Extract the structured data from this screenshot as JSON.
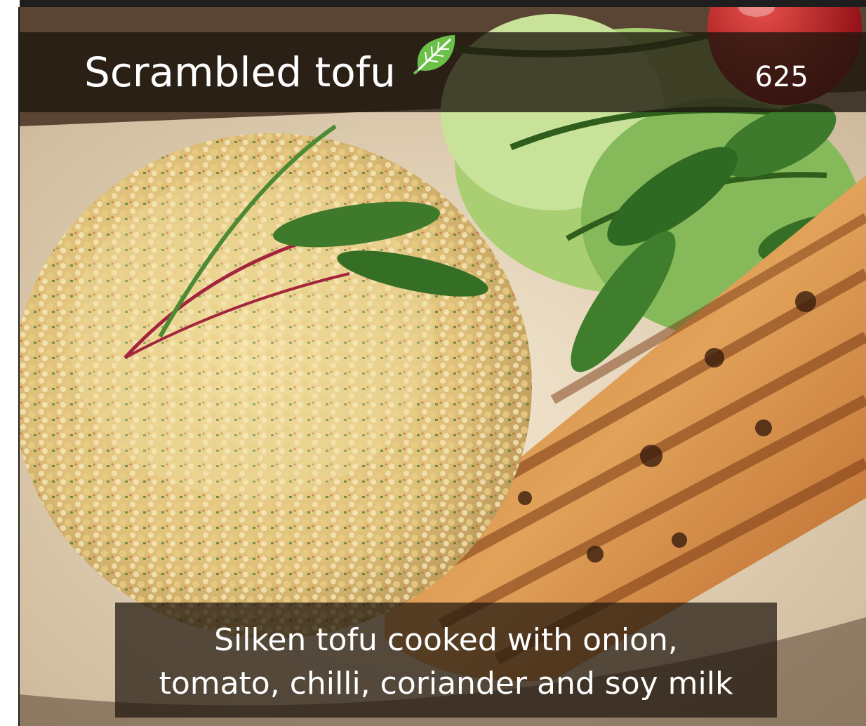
{
  "menu_item": {
    "title": "Scrambled tofu",
    "price": "625",
    "vegan_icon": "leaf-icon",
    "description_lines": [
      "Silken tofu cooked with onion,",
      "tomato, chilli, coriander and soy milk"
    ]
  },
  "colors": {
    "overlay": "#1e160e",
    "text": "#ffffff",
    "leaf": "#6cc04a"
  },
  "photo": {
    "subject": "dish-photo"
  }
}
